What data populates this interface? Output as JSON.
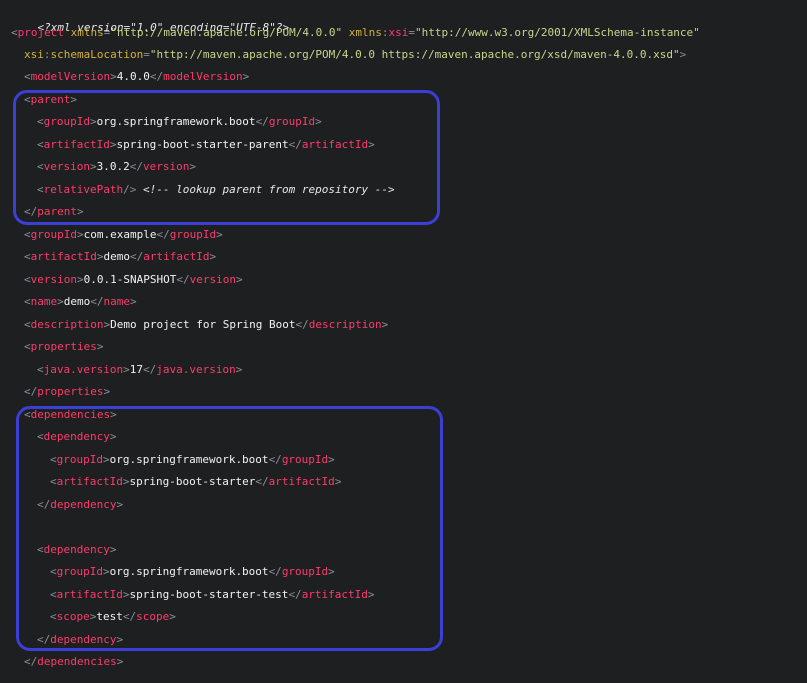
{
  "xml_declaration": "<?xml version=\"1.0\" encoding=\"UTF-8\"?>",
  "project": {
    "tag": "project",
    "xmlns_attr": "xmlns",
    "xmlns_val": "\"http://maven.apache.org/POM/4.0.0\"",
    "xsi_ns": "xmlns",
    "xsi_attr": "xsi",
    "xsi_val": "\"http://www.w3.org/2001/XMLSchema-instance\"",
    "schema_ns": "xsi",
    "schema_attr": "schemaLocation",
    "schema_val": "\"http://maven.apache.org/POM/4.0.0 https://maven.apache.org/xsd/maven-4.0.0.xsd\""
  },
  "model_version": {
    "tag": "modelVersion",
    "value": "4.0.0"
  },
  "parent": {
    "tag": "parent",
    "group_id": {
      "tag": "groupId",
      "value": "org.springframework.boot"
    },
    "artifact_id": {
      "tag": "artifactId",
      "value": "spring-boot-starter-parent"
    },
    "version": {
      "tag": "version",
      "value": "3.0.2"
    },
    "relative_path": {
      "tag": "relativePath",
      "comment": "<!-- lookup parent from repository -->"
    }
  },
  "group_id": {
    "tag": "groupId",
    "value": "com.example"
  },
  "artifact_id": {
    "tag": "artifactId",
    "value": "demo"
  },
  "version": {
    "tag": "version",
    "value": "0.0.1-SNAPSHOT"
  },
  "name": {
    "tag": "name",
    "value": "demo"
  },
  "description": {
    "tag": "description",
    "value": "Demo project for Spring Boot"
  },
  "properties": {
    "tag": "properties",
    "java_version": {
      "tag": "java.version",
      "value": "17"
    }
  },
  "dependencies": {
    "tag": "dependencies",
    "dependency_tag": "dependency",
    "items": [
      {
        "group_id": {
          "tag": "groupId",
          "value": "org.springframework.boot"
        },
        "artifact_id": {
          "tag": "artifactId",
          "value": "spring-boot-starter"
        }
      },
      {
        "group_id": {
          "tag": "groupId",
          "value": "org.springframework.boot"
        },
        "artifact_id": {
          "tag": "artifactId",
          "value": "spring-boot-starter-test"
        },
        "scope": {
          "tag": "scope",
          "value": "test"
        }
      }
    ]
  },
  "colors": {
    "background": "#1d1f21",
    "tag": "#ff3b6b",
    "attribute": "#d4b23a",
    "string": "#c9d68a",
    "text": "#f2f2f2",
    "highlight_box": "#3b3fd6"
  }
}
